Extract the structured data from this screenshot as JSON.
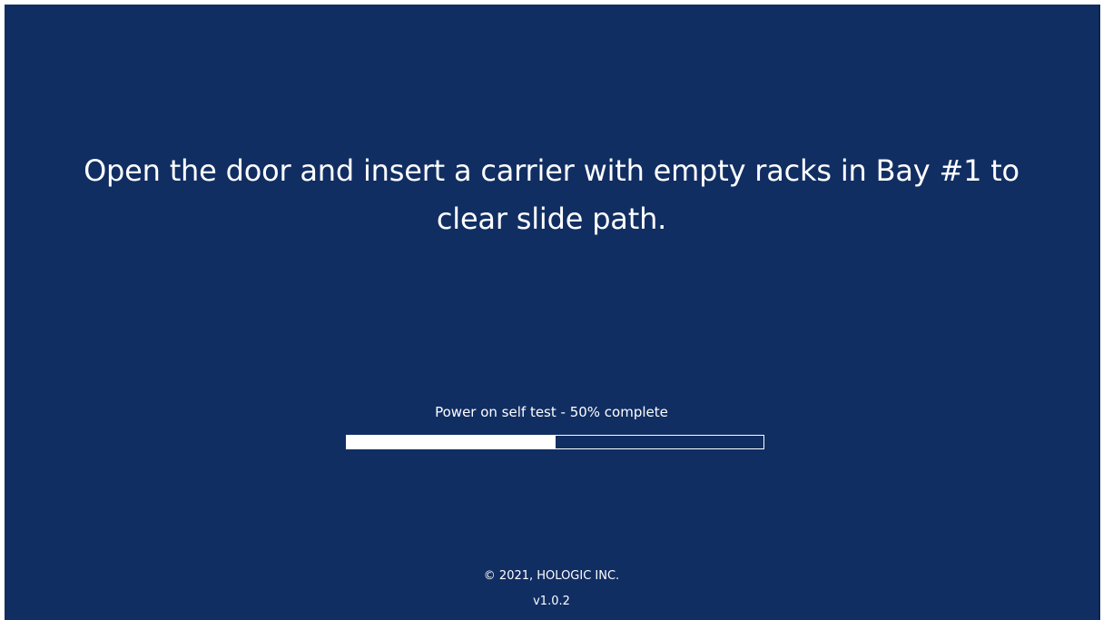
{
  "screen": {
    "background_color": "#112e63",
    "text_color": "#ffffff"
  },
  "instruction": {
    "line1": "Open the door and insert a carrier with empty racks in Bay #1 to",
    "line2": "clear slide path."
  },
  "progress": {
    "label": "Power on self test - 50% complete",
    "percent": 50
  },
  "footer": {
    "copyright": "© 2021, HOLOGIC INC.",
    "version": "v1.0.2"
  }
}
